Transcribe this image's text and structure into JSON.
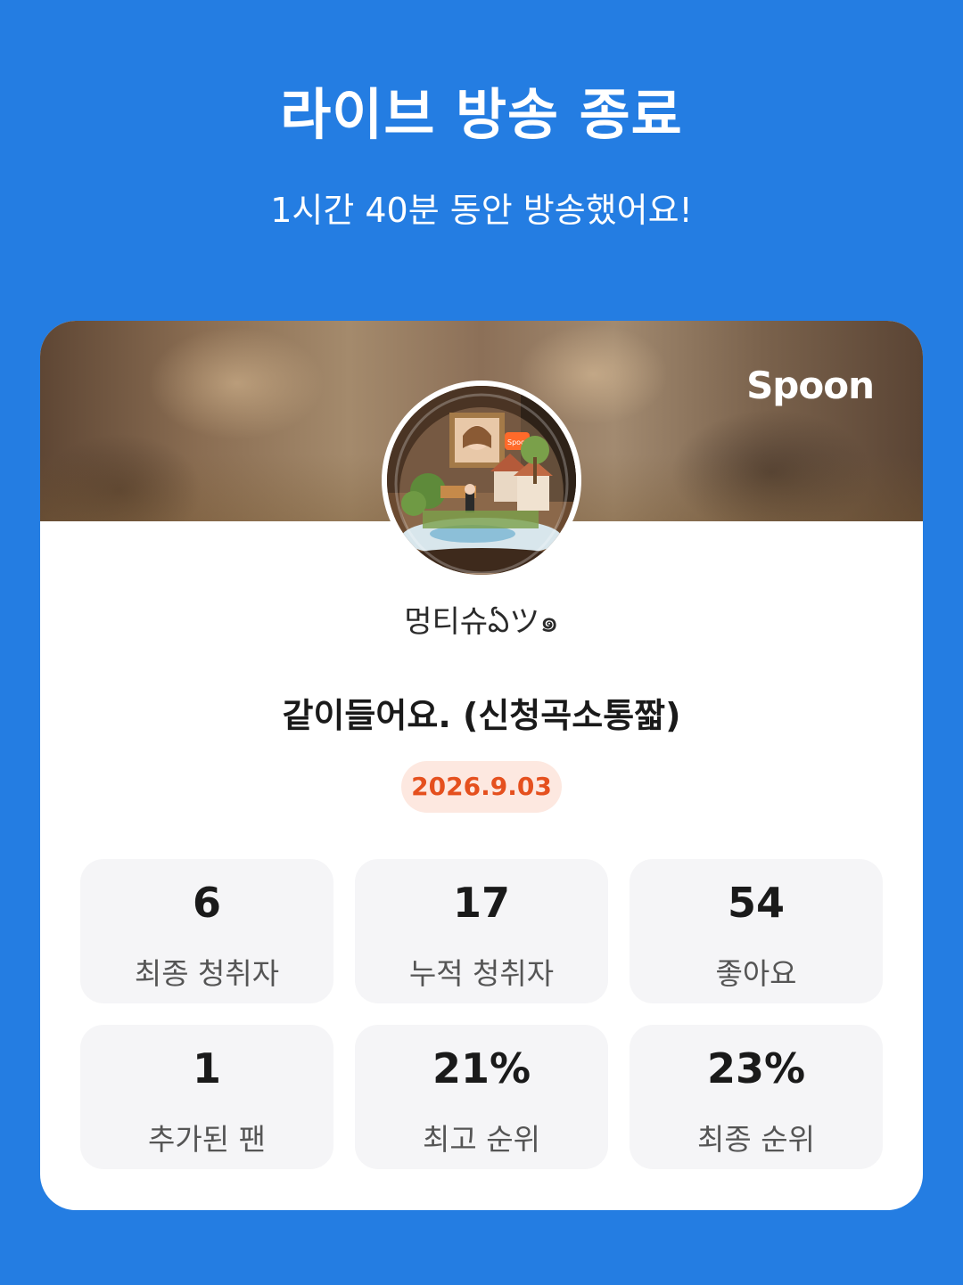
{
  "header": {
    "title": "라이브 방송 종료",
    "subtitle": "1시간 40분 동안 방송했어요!"
  },
  "card": {
    "brand": "Spoon",
    "avatar_badge": "Spoon",
    "nickname": "멍티슈ఏツ๑",
    "live_title": "같이들어요. (신청곡소통짧)",
    "date": "2026.9.03"
  },
  "stats": [
    {
      "value": "6",
      "label": "최종 청취자"
    },
    {
      "value": "17",
      "label": "누적 청취자"
    },
    {
      "value": "54",
      "label": "좋아요"
    },
    {
      "value": "1",
      "label": "추가된 팬"
    },
    {
      "value": "21%",
      "label": "최고 순위"
    },
    {
      "value": "23%",
      "label": "최종 순위"
    }
  ],
  "colors": {
    "background": "#247DE2",
    "card": "#FFFFFF",
    "stat_box": "#F5F5F7",
    "date_badge_bg": "#FDE8E0",
    "date_badge_text": "#E5501E"
  }
}
